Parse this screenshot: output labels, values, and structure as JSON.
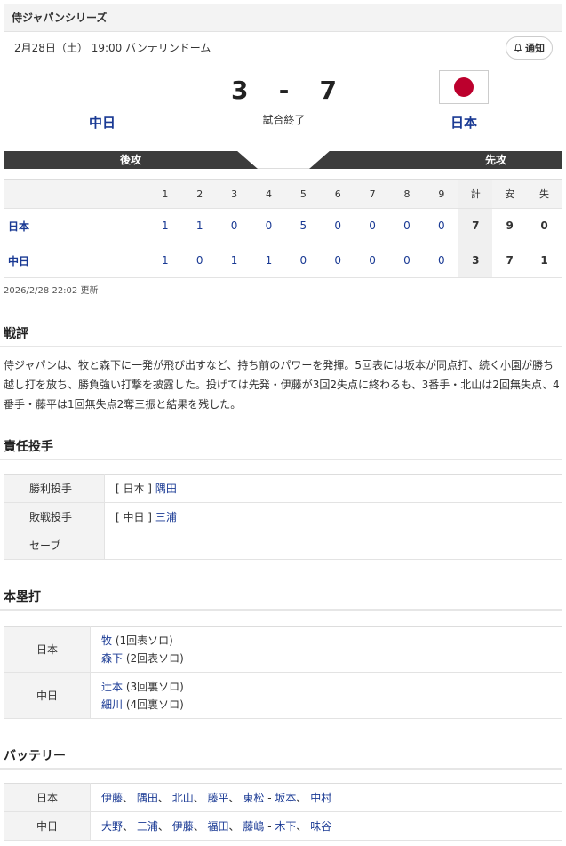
{
  "header": {
    "series": "侍ジャパンシリーズ",
    "datetime": "2月28日（土） 19:00 バンテリンドーム",
    "notify_label": "通知",
    "home_team": "中日",
    "away_team": "日本",
    "home_score": "3",
    "away_score": "7",
    "separator": "-",
    "status": "試合終了",
    "home_side": "後攻",
    "away_side": "先攻",
    "away_flag": "japan-flag-icon"
  },
  "linescore": {
    "innings": [
      "1",
      "2",
      "3",
      "4",
      "5",
      "6",
      "7",
      "8",
      "9"
    ],
    "total_label": "計",
    "hits_label": "安",
    "errors_label": "失",
    "rows": [
      {
        "team": "日本",
        "innings": [
          "1",
          "1",
          "0",
          "0",
          "5",
          "0",
          "0",
          "0",
          "0"
        ],
        "total": "7",
        "hits": "9",
        "errors": "0"
      },
      {
        "team": "中日",
        "innings": [
          "1",
          "0",
          "1",
          "1",
          "0",
          "0",
          "0",
          "0",
          "0"
        ],
        "total": "3",
        "hits": "7",
        "errors": "1"
      }
    ],
    "updated": "2026/2/28 22:02 更新"
  },
  "review": {
    "title": "戦評",
    "text": "侍ジャパンは、牧と森下に一発が飛び出すなど、持ち前のパワーを発揮。5回表には坂本が同点打、続く小園が勝ち越し打を放ち、勝負強い打撃を披露した。投げては先発・伊藤が3回2失点に終わるも、3番手・北山は2回無失点、4番手・藤平は1回無失点2奪三振と結果を残した。"
  },
  "pitchers": {
    "title": "責任投手",
    "win_label": "勝利投手",
    "win_team": "[ 日本 ]",
    "win_name": "隅田",
    "loss_label": "敗戦投手",
    "loss_team": "[ 中日 ]",
    "loss_name": "三浦",
    "save_label": "セーブ",
    "save_name": ""
  },
  "homeruns": {
    "title": "本塁打",
    "teams": [
      {
        "team": "日本",
        "entries": [
          {
            "name": "牧",
            "detail": "(1回表ソロ)"
          },
          {
            "name": "森下",
            "detail": "(2回表ソロ)"
          }
        ]
      },
      {
        "team": "中日",
        "entries": [
          {
            "name": "辻本",
            "detail": "(3回裏ソロ)"
          },
          {
            "name": "細川",
            "detail": "(4回裏ソロ)"
          }
        ]
      }
    ]
  },
  "battery": {
    "title": "バッテリー",
    "rows": [
      {
        "team": "日本",
        "pitchers": [
          "伊藤",
          "隅田",
          "北山",
          "藤平",
          "東松"
        ],
        "catchers": [
          "坂本",
          "中村"
        ]
      },
      {
        "team": "中日",
        "pitchers": [
          "大野",
          "三浦",
          "伊藤",
          "福田",
          "藤嶋"
        ],
        "catchers": [
          "木下",
          "味谷"
        ]
      }
    ]
  }
}
